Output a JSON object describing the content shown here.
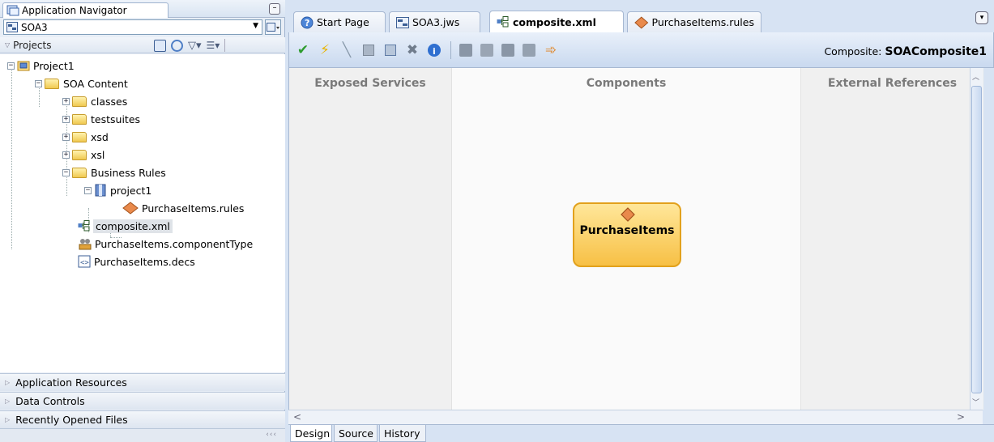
{
  "navigator": {
    "title": "Application Navigator",
    "app_selector": {
      "value": "SOA3"
    },
    "projects_label": "Projects",
    "tree": {
      "project1": "Project1",
      "soa_content": "SOA Content",
      "classes": "classes",
      "testsuites": "testsuites",
      "xsd": "xsd",
      "xsl": "xsl",
      "business_rules": "Business Rules",
      "rules_project": "project1",
      "rules_file": "PurchaseItems.rules",
      "composite": "composite.xml",
      "component_type": "PurchaseItems.componentType",
      "decs": "PurchaseItems.decs"
    },
    "accordions": [
      "Application Resources",
      "Data Controls",
      "Recently Opened Files"
    ]
  },
  "editor": {
    "tabs": [
      "Start Page",
      "SOA3.jws",
      "composite.xml",
      "PurchaseItems.rules"
    ],
    "active_tab": "composite.xml",
    "composite_prefix": "Composite:",
    "composite_name": "SOAComposite1",
    "lanes": {
      "services": "Exposed Services",
      "components": "Components",
      "references": "External References"
    },
    "component": {
      "name": "PurchaseItems",
      "icon": "business-rule-diamond-icon"
    },
    "bottom_tabs": [
      "Design",
      "Source",
      "History"
    ]
  },
  "colors": {
    "chrome": "#d7e3f3",
    "component_fill": "#f7c045",
    "component_border": "#e2a11c",
    "check": "#2e9c2e",
    "bolt": "#e8b400"
  }
}
